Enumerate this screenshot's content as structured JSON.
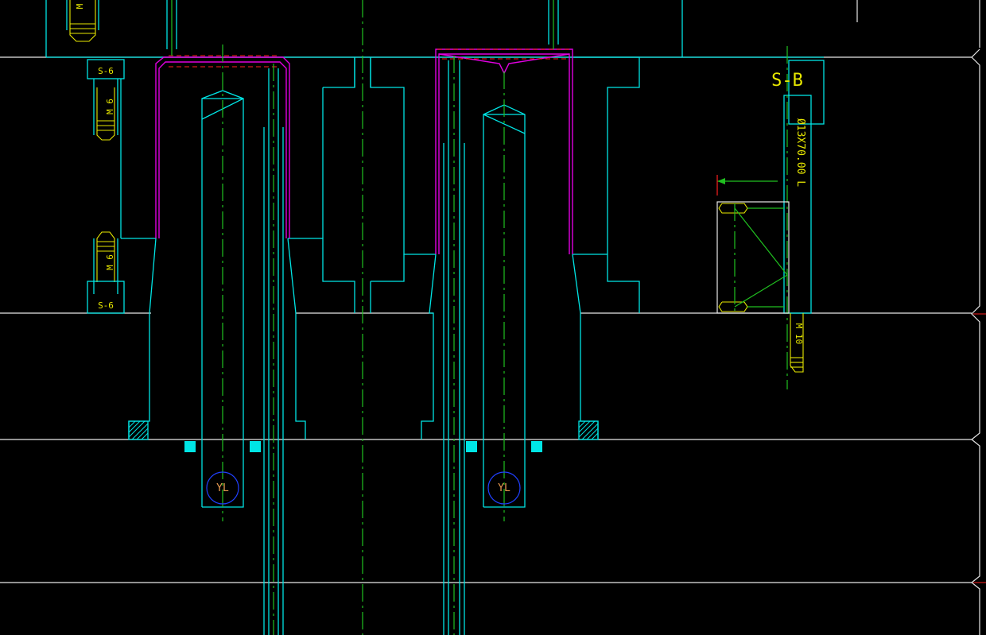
{
  "drawing": {
    "background": "#000000",
    "colors": {
      "outline": "#00e5e5",
      "plate_lines": "#e8e8e8",
      "insert": "#e000e0",
      "centerline": "#20c020",
      "annotation": "#e8e800",
      "hidden": "#ff2020",
      "cooling_circle": "#2040ff",
      "marker": "#e89a50"
    },
    "labels": {
      "screw_top": "S-6",
      "screw_bottom": "S-6",
      "thread_upper": "M 6",
      "thread_lower": "M 6",
      "top_left_thread": "M",
      "spring_label": "S-B",
      "spring_dim": "Ø13X70.00 L",
      "bottom_thread": "M 10",
      "marker_left": "YL",
      "marker_right": "YL"
    }
  }
}
